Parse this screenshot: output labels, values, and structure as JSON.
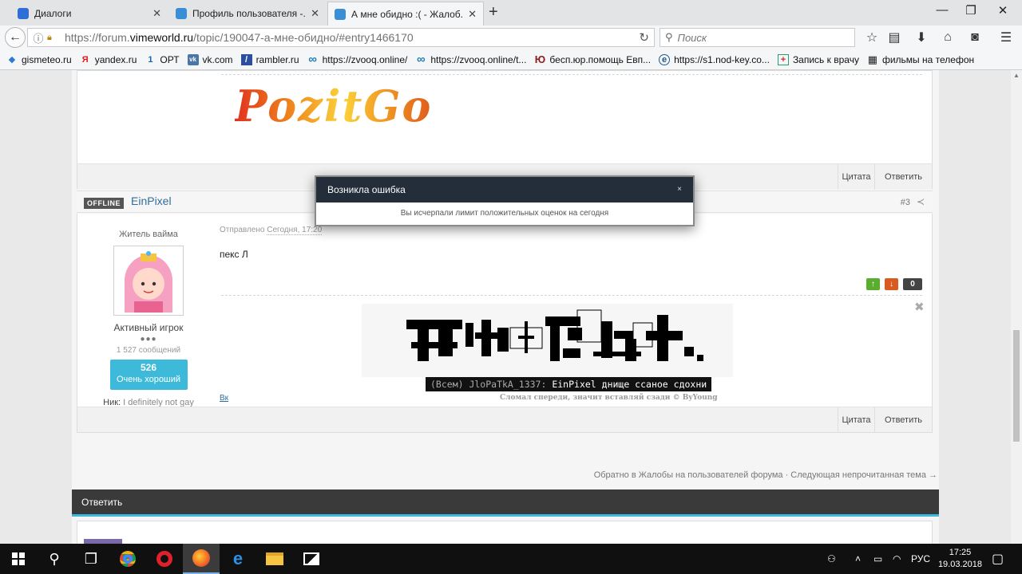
{
  "browser": {
    "tabs": [
      {
        "label": "Диалоги",
        "icon_color": "#2d6fd6"
      },
      {
        "label": "Профиль пользователя -...",
        "icon_color": "#3a8ed6"
      },
      {
        "label": "А мне обидно :( - Жалоб...",
        "icon_color": "#3a8ed6"
      }
    ],
    "new_tab": "+",
    "window_controls": {
      "minimize": "—",
      "maximize": "❐",
      "close": "✕"
    },
    "url_prefix": "https://forum.",
    "url_domain": "vimeworld.ru",
    "url_path": "/topic/190047-а-мне-обидно/#entry1466170",
    "search_placeholder": "Поиск",
    "bookmarks": [
      {
        "label": "gismeteo.ru",
        "icon": "◆",
        "color": "#2b7bd4"
      },
      {
        "label": "yandex.ru",
        "icon": "Я",
        "color": "#e21b1b"
      },
      {
        "label": "ОРТ",
        "icon": "1",
        "color": "#1463b5"
      },
      {
        "label": "vk.com",
        "icon": "vk",
        "color": "#4a76a8"
      },
      {
        "label": "rambler.ru",
        "icon": "/",
        "color": "#2c4ea0"
      },
      {
        "label": "https://zvooq.online/",
        "icon": "∞",
        "color": "#1b7fb5"
      },
      {
        "label": "https://zvooq.online/t...",
        "icon": "∞",
        "color": "#1b7fb5"
      },
      {
        "label": "бесп.юр.помощь Евп...",
        "icon": "Ю",
        "color": "#8a1c1c"
      },
      {
        "label": "https://s1.nod-key.co...",
        "icon": "e",
        "color": "#1d5a8a"
      },
      {
        "label": "Запись к врачу",
        "icon": "+",
        "color": "#d22"
      },
      {
        "label": "фильмы на телефон",
        "icon": "▦",
        "color": "#222"
      }
    ]
  },
  "post_prev": {
    "signature_logo": "PozitGo",
    "quote_label": "Цитата",
    "reply_label": "Ответить"
  },
  "post": {
    "status_badge": "OFFLINE",
    "author": "EinPixel",
    "number": "#3",
    "rank": "Житель вайма",
    "group": "Активный игрок",
    "pips": "●●●",
    "post_count": "1 527 сообщений",
    "reputation_value": "526",
    "reputation_label": "Очень хороший",
    "nick_label": "Ник:",
    "nick_value": "I definitely not gay",
    "sent_label": "Отправлено",
    "sent_time": "Сегодня, 17:20",
    "text": "пекс Л",
    "vote_up": "↑",
    "vote_down": "↓",
    "vote_count": "0",
    "sig_chat_prefix": "(Всем) JloPaTkA_1337:",
    "sig_chat_text": " EinPixel днище ссаное сдохни",
    "sig_credit": "Сломал спереди, значит вставляй сзади © ByYoung",
    "sig_link": "Вк",
    "quote_label": "Цитата",
    "reply_label": "Ответить"
  },
  "topic_nav": "Обратно в Жалобы на пользователей форума · Следующая непрочитанная тема →",
  "reply_section_title": "Ответить",
  "dialog": {
    "title": "Возникла ошибка",
    "close": "×",
    "message": "Вы исчерпали лимит положительных оценок на сегодня"
  },
  "taskbar": {
    "time": "17:25",
    "date": "19.03.2018",
    "lang": "РУС"
  },
  "colors": {
    "accent": "#3dbad9",
    "link": "#2f6e9c",
    "dialog_header": "#232e3a",
    "vote_up": "#5aae2f",
    "vote_down": "#d95b1f"
  }
}
